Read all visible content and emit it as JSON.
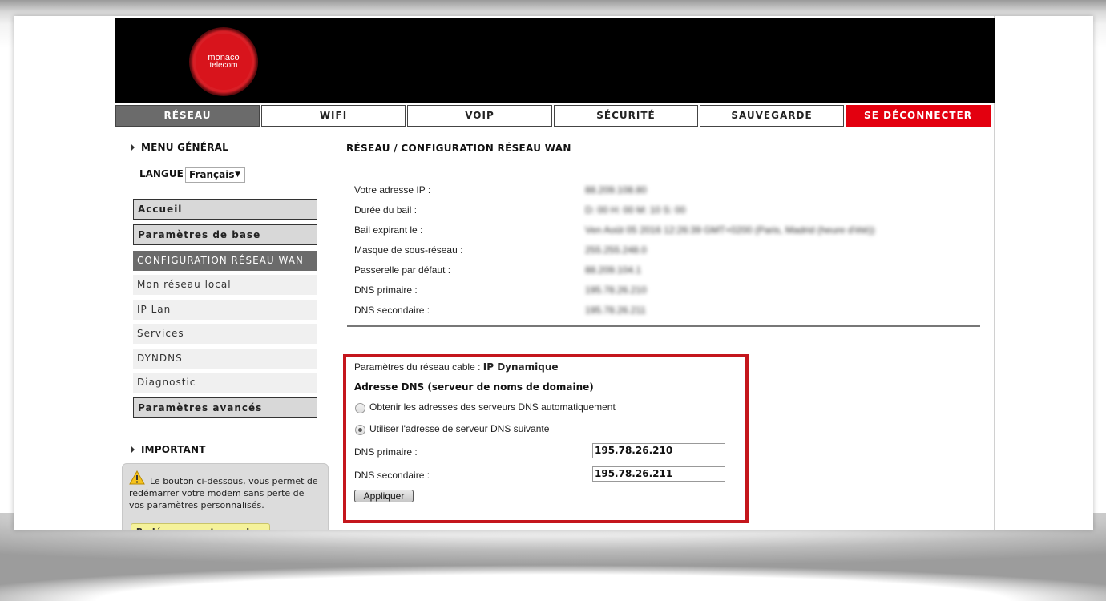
{
  "brand": {
    "logo_line1": "monaco",
    "logo_line2": "telecom",
    "accent_color": "#e3000f"
  },
  "nav": {
    "tabs": [
      {
        "label": "RÉSEAU",
        "active": true
      },
      {
        "label": "WIFI"
      },
      {
        "label": "VOIP"
      },
      {
        "label": "SÉCURITÉ"
      },
      {
        "label": "SAUVEGARDE"
      },
      {
        "label": "SE DÉCONNECTER"
      }
    ]
  },
  "sidebar": {
    "menu_title": "MENU GÉNÉRAL",
    "language_label": "LANGUE",
    "language_value": "Français",
    "items": [
      {
        "label": "Accueil",
        "style": "box"
      },
      {
        "label": "Paramètres de base",
        "style": "box"
      },
      {
        "label": "CONFIGURATION RÉSEAU WAN",
        "style": "active"
      },
      {
        "label": "Mon réseau local",
        "style": "sub"
      },
      {
        "label": "IP Lan",
        "style": "sub"
      },
      {
        "label": "Services",
        "style": "sub"
      },
      {
        "label": "DYNDNS",
        "style": "sub"
      },
      {
        "label": "Diagnostic",
        "style": "sub"
      },
      {
        "label": "Paramètres avancés",
        "style": "box"
      }
    ],
    "important_title": "IMPORTANT",
    "important_text": "Le bouton ci-dessous, vous permet de redémarrer votre modem sans perte de vos paramètres personnalisés.",
    "warning_icon": "warning-icon",
    "restart_button": "Redémarrer votre modem"
  },
  "main": {
    "heading": "RÉSEAU / CONFIGURATION RÉSEAU WAN",
    "info": [
      {
        "label": "Votre adresse IP :",
        "value": "88.209.108.80"
      },
      {
        "label": "Durée du bail :",
        "value": "D: 00 H: 00 M: 10 S: 00"
      },
      {
        "label": "Bail expirant le :",
        "value": "Ven Août 05 2016 12:26:39 GMT+0200 (Paris, Madrid (heure d'été))"
      },
      {
        "label": "Masque de sous-réseau :",
        "value": "255.255.248.0"
      },
      {
        "label": "Passerelle par défaut :",
        "value": "88.209.104.1"
      },
      {
        "label": "DNS primaire :",
        "value": "195.78.26.210"
      },
      {
        "label": "DNS secondaire :",
        "value": "195.78.26.211"
      }
    ],
    "dns": {
      "cable_label": "Paramètres du réseau cable :",
      "cable_value": "IP Dynamique",
      "heading": "Adresse DNS (serveur de noms de domaine)",
      "option_auto": "Obtenir les adresses des serveurs DNS automatiquement",
      "option_manual": "Utiliser l'adresse de serveur DNS suivante",
      "selected": "manual",
      "primary_label": "DNS primaire :",
      "primary_value": "195.78.26.210",
      "secondary_label": "DNS secondaire :",
      "secondary_value": "195.78.26.211",
      "apply_label": "Appliquer",
      "highlight_color": "#c4161c"
    }
  }
}
